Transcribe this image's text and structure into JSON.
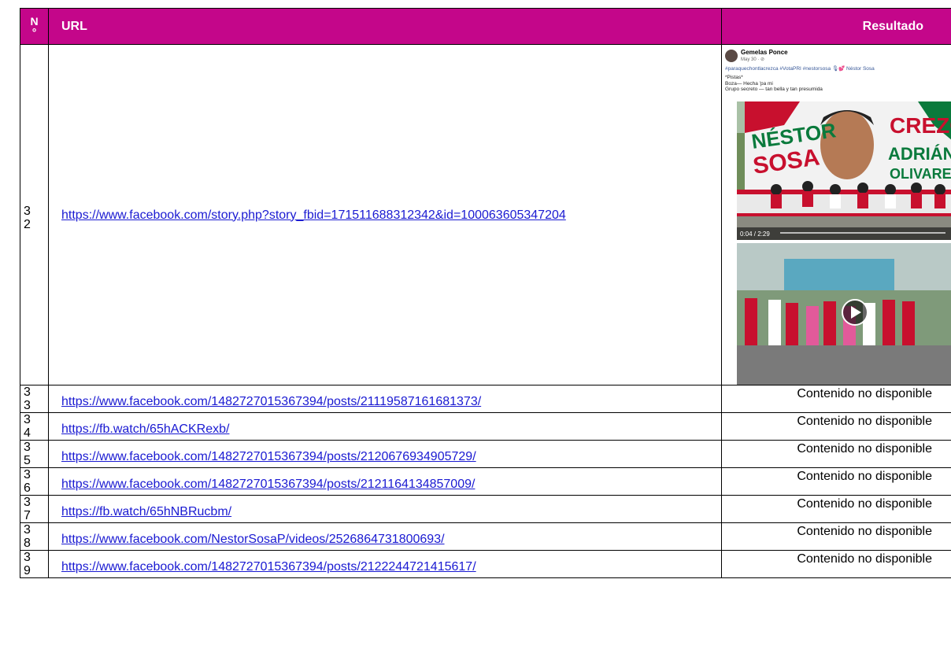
{
  "headers": {
    "no": "N\n°",
    "url": "URL",
    "result": "Resultado"
  },
  "colors": {
    "header_bg": "#c4068a",
    "link": "#1a1ad2"
  },
  "rows": [
    {
      "no": "3\n2",
      "url": "https://www.facebook.com/story.php?story_fbid=171511688312342&id=100063605347204",
      "result": "",
      "post": {
        "name": "Gemelas Ponce",
        "date": "May 30 · ⊘",
        "tags": "#paraquechontlacrezca #VotaPRI #nestorsosa 🎙💕 Néstor Sosa",
        "text": "*Pistas*\nBoza— Hecha 'pa mi\nGrupo secreto — tan bella y tan presumida",
        "banner_words": [
          "NÉSTOR",
          "SOSA",
          "CREZCA",
          "ADRIÁN",
          "OLIVARES"
        ],
        "video_time": "0:04 / 2:29"
      }
    },
    {
      "no": "3\n3",
      "url": "https://www.facebook.com/1482727015367394/posts/21119587161681373/",
      "result": "Contenido no disponible"
    },
    {
      "no": "3\n4",
      "url": "https://fb.watch/65hACKRexb/",
      "result": "Contenido no disponible"
    },
    {
      "no": "3\n5",
      "url": "https://www.facebook.com/1482727015367394/posts/2120676934905729/",
      "result": "Contenido no disponible"
    },
    {
      "no": "3\n6",
      "url": "https://www.facebook.com/1482727015367394/posts/2121164134857009/",
      "result": "Contenido no disponible"
    },
    {
      "no": "3\n7",
      "url": "https://fb.watch/65hNBRucbm/",
      "result": "Contenido no disponible"
    },
    {
      "no": "3\n8",
      "url": "https://www.facebook.com/NestorSosaP/videos/2526864731800693/",
      "result": "Contenido no disponible"
    },
    {
      "no": "3\n9",
      "url": "https://www.facebook.com/1482727015367394/posts/2122244721415617/",
      "result": "Contenido no disponible"
    }
  ]
}
